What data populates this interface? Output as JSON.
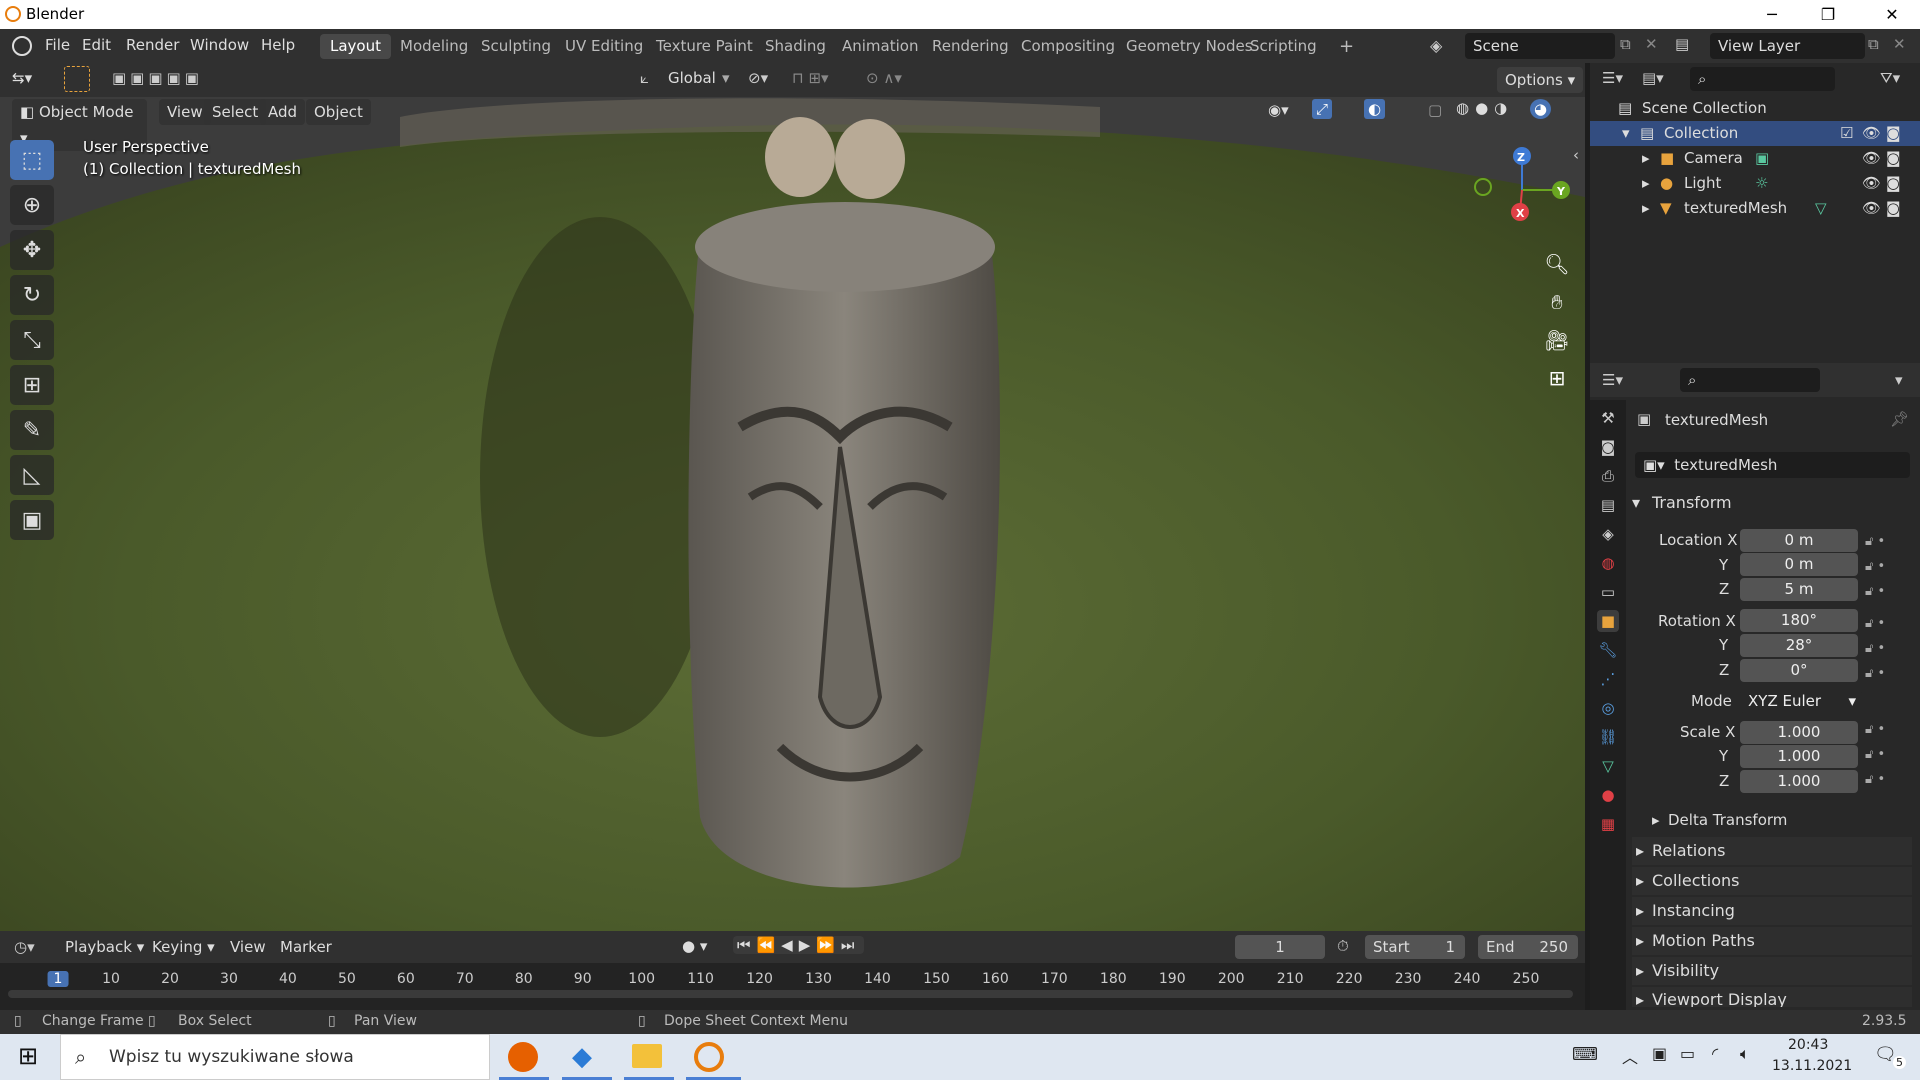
{
  "window": {
    "title": "Blender",
    "minimize": "─",
    "maximize": "❐",
    "close": "✕"
  },
  "menu": [
    "File",
    "Edit",
    "Render",
    "Window",
    "Help"
  ],
  "workspaces": [
    "Layout",
    "Modeling",
    "Sculpting",
    "UV Editing",
    "Texture Paint",
    "Shading",
    "Animation",
    "Rendering",
    "Compositing",
    "Geometry Nodes",
    "Scripting"
  ],
  "active_workspace": "Layout",
  "add_tab": "+",
  "scene": "Scene",
  "view_layer": "View Layer",
  "header": {
    "transform_orientation": "Global",
    "options": "Options"
  },
  "viewport": {
    "mode": "Object Mode",
    "view": "View",
    "select": "Select",
    "add": "Add",
    "object": "Object",
    "perspective": "User Perspective",
    "collection_info": "(1) Collection | texturedMesh",
    "gizmo_x": "X",
    "gizmo_y": "Y",
    "gizmo_z": "Z"
  },
  "outliner": {
    "scene_collection": "Scene Collection",
    "collection": "Collection",
    "items": [
      "Camera",
      "Light",
      "texturedMesh"
    ]
  },
  "properties": {
    "object_name": "texturedMesh",
    "datablock": "texturedMesh",
    "transform": "Transform",
    "location_label": "Location X",
    "location": [
      "0 m",
      "0 m",
      "5 m"
    ],
    "rotation_label": "Rotation X",
    "rotation": [
      "180°",
      "28°",
      "0°"
    ],
    "mode_label": "Mode",
    "mode": "XYZ Euler",
    "scale_label": "Scale X",
    "scale": [
      "1.000",
      "1.000",
      "1.000"
    ],
    "y": "Y",
    "z": "Z",
    "delta": "Delta Transform",
    "sections": [
      "Relations",
      "Collections",
      "Instancing",
      "Motion Paths",
      "Visibility",
      "Viewport Display"
    ]
  },
  "timeline": {
    "playback": "Playback",
    "keying": "Keying",
    "view": "View",
    "marker": "Marker",
    "current_frame": "1",
    "start_label": "Start",
    "start": "1",
    "end_label": "End",
    "end": "250",
    "ticks": [
      "1",
      "10",
      "20",
      "30",
      "40",
      "50",
      "60",
      "70",
      "80",
      "90",
      "100",
      "110",
      "120",
      "130",
      "140",
      "150",
      "160",
      "170",
      "180",
      "190",
      "200",
      "210",
      "220",
      "230",
      "240",
      "250"
    ]
  },
  "status": {
    "change_frame": "Change Frame",
    "box_select": "Box Select",
    "pan_view": "Pan View",
    "context_menu": "Dope Sheet Context Menu",
    "version": "2.93.5"
  },
  "taskbar": {
    "search_placeholder": "Wpisz tu wyszukiwane słowa",
    "time": "20:43",
    "date": "13.11.2021",
    "notifications": "5"
  }
}
